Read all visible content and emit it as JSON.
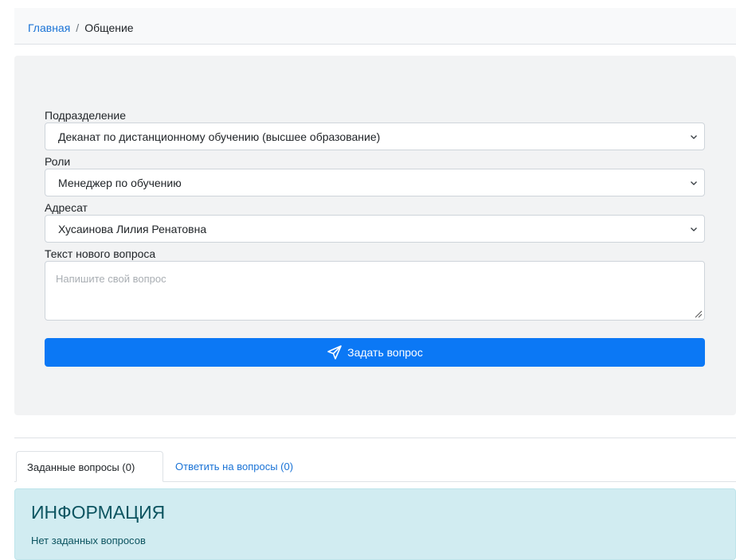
{
  "breadcrumb": {
    "home": "Главная",
    "separator": "/",
    "current": "Общение"
  },
  "form": {
    "department_label": "Подразделение",
    "department_value": "Деканат по дистанционному обучению (высшее образование)",
    "role_label": "Роли",
    "role_value": "Менеджер по обучению",
    "recipient_label": "Адресат",
    "recipient_value": "Хусаинова Лилия Ренатовна",
    "question_label": "Текст нового вопроса",
    "question_placeholder": "Напишите свой вопрос",
    "submit_label": "Задать вопрос",
    "submit_icon": "paper-plane-icon"
  },
  "tabs": [
    {
      "label": "Заданные вопросы (0)",
      "active": true
    },
    {
      "label": "Ответить на вопросы (0)",
      "active": false
    }
  ],
  "info": {
    "title": "ИНФОРМАЦИЯ",
    "text": "Нет заданных вопросов"
  },
  "colors": {
    "primary": "#0b78f5",
    "link": "#1a73d6",
    "info_bg": "#d1ecf1",
    "info_text": "#0c5460",
    "card_bg": "#f2f3f4"
  }
}
